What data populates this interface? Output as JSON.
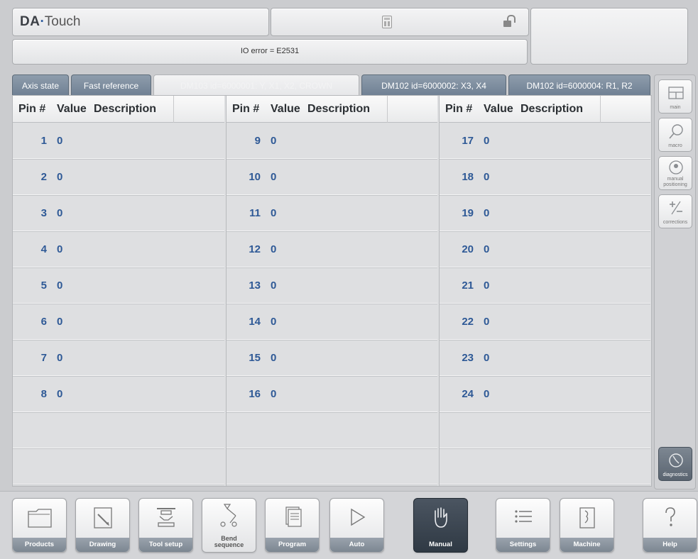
{
  "header": {
    "brand_bold": "DA",
    "brand_dot": "·",
    "brand_light": "Touch",
    "status_message": "IO error = E2531"
  },
  "tabs": [
    {
      "label": "Axis state",
      "active": false
    },
    {
      "label": "Fast reference",
      "active": false
    },
    {
      "label": "DM103 id=6000001: Y, X1, X2, CROWN",
      "active": true
    },
    {
      "label": "DM102 id=6000002: X3, X4",
      "active": false
    },
    {
      "label": "DM102 id=6000004: R1, R2",
      "active": false
    }
  ],
  "table": {
    "headers": {
      "pin": "Pin #",
      "value": "Value",
      "description": "Description"
    },
    "columns": [
      [
        {
          "pin": "1",
          "value": "0",
          "description": ""
        },
        {
          "pin": "2",
          "value": "0",
          "description": ""
        },
        {
          "pin": "3",
          "value": "0",
          "description": ""
        },
        {
          "pin": "4",
          "value": "0",
          "description": ""
        },
        {
          "pin": "5",
          "value": "0",
          "description": ""
        },
        {
          "pin": "6",
          "value": "0",
          "description": ""
        },
        {
          "pin": "7",
          "value": "0",
          "description": ""
        },
        {
          "pin": "8",
          "value": "0",
          "description": ""
        },
        {
          "pin": "",
          "value": "",
          "description": ""
        },
        {
          "pin": "",
          "value": "",
          "description": ""
        }
      ],
      [
        {
          "pin": "9",
          "value": "0",
          "description": ""
        },
        {
          "pin": "10",
          "value": "0",
          "description": ""
        },
        {
          "pin": "11",
          "value": "0",
          "description": ""
        },
        {
          "pin": "12",
          "value": "0",
          "description": ""
        },
        {
          "pin": "13",
          "value": "0",
          "description": ""
        },
        {
          "pin": "14",
          "value": "0",
          "description": ""
        },
        {
          "pin": "15",
          "value": "0",
          "description": ""
        },
        {
          "pin": "16",
          "value": "0",
          "description": ""
        },
        {
          "pin": "",
          "value": "",
          "description": ""
        },
        {
          "pin": "",
          "value": "",
          "description": ""
        }
      ],
      [
        {
          "pin": "17",
          "value": "0",
          "description": ""
        },
        {
          "pin": "18",
          "value": "0",
          "description": ""
        },
        {
          "pin": "19",
          "value": "0",
          "description": ""
        },
        {
          "pin": "20",
          "value": "0",
          "description": ""
        },
        {
          "pin": "21",
          "value": "0",
          "description": ""
        },
        {
          "pin": "22",
          "value": "0",
          "description": ""
        },
        {
          "pin": "23",
          "value": "0",
          "description": ""
        },
        {
          "pin": "24",
          "value": "0",
          "description": ""
        },
        {
          "pin": "",
          "value": "",
          "description": ""
        },
        {
          "pin": "",
          "value": "",
          "description": ""
        }
      ]
    ]
  },
  "sidebar": {
    "main_label": "main",
    "macro_label": "macro",
    "manual_positioning_label_1": "manual",
    "manual_positioning_label_2": "positioning",
    "corrections_label": "corrections",
    "diagnostics_label": "diagnostics"
  },
  "bottom_nav": {
    "products": "Products",
    "drawing": "Drawing",
    "tool_setup": "Tool setup",
    "bend_sequence_1": "Bend",
    "bend_sequence_2": "sequence",
    "program": "Program",
    "auto": "Auto",
    "manual": "Manual",
    "settings": "Settings",
    "machine": "Machine",
    "help": "Help"
  },
  "icons": {
    "calculator": "calculator-icon",
    "lock": "unlocked-padlock-icon",
    "main": "window-layout-icon",
    "macro": "magnifier-icon",
    "manual_positioning": "dial-icon",
    "corrections": "plus-minus-icon",
    "diagnostics": "gauge-icon",
    "products": "folder-icon",
    "drawing": "pencil-page-icon",
    "tool_setup": "press-tool-icon",
    "bend_sequence": "bend-robot-icon",
    "program": "document-stack-icon",
    "auto": "play-icon",
    "manual": "hand-icon",
    "settings": "list-icon",
    "machine": "machine-page-icon",
    "help": "question-mark-icon"
  },
  "colors": {
    "tab_inactive": "#7f8fa0",
    "active_nav": "#3a4450",
    "pin_text": "#2e5996"
  }
}
